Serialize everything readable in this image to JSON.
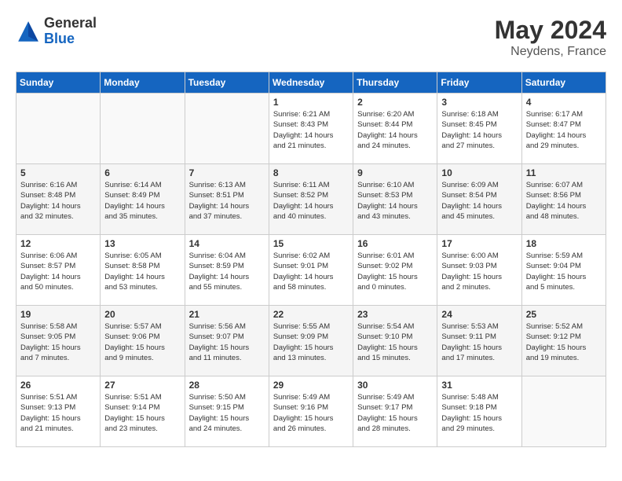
{
  "header": {
    "logo_general": "General",
    "logo_blue": "Blue",
    "month_year": "May 2024",
    "location": "Neydens, France"
  },
  "days_of_week": [
    "Sunday",
    "Monday",
    "Tuesday",
    "Wednesday",
    "Thursday",
    "Friday",
    "Saturday"
  ],
  "weeks": [
    [
      {
        "day": "",
        "content": ""
      },
      {
        "day": "",
        "content": ""
      },
      {
        "day": "",
        "content": ""
      },
      {
        "day": "1",
        "content": "Sunrise: 6:21 AM\nSunset: 8:43 PM\nDaylight: 14 hours\nand 21 minutes."
      },
      {
        "day": "2",
        "content": "Sunrise: 6:20 AM\nSunset: 8:44 PM\nDaylight: 14 hours\nand 24 minutes."
      },
      {
        "day": "3",
        "content": "Sunrise: 6:18 AM\nSunset: 8:45 PM\nDaylight: 14 hours\nand 27 minutes."
      },
      {
        "day": "4",
        "content": "Sunrise: 6:17 AM\nSunset: 8:47 PM\nDaylight: 14 hours\nand 29 minutes."
      }
    ],
    [
      {
        "day": "5",
        "content": "Sunrise: 6:16 AM\nSunset: 8:48 PM\nDaylight: 14 hours\nand 32 minutes."
      },
      {
        "day": "6",
        "content": "Sunrise: 6:14 AM\nSunset: 8:49 PM\nDaylight: 14 hours\nand 35 minutes."
      },
      {
        "day": "7",
        "content": "Sunrise: 6:13 AM\nSunset: 8:51 PM\nDaylight: 14 hours\nand 37 minutes."
      },
      {
        "day": "8",
        "content": "Sunrise: 6:11 AM\nSunset: 8:52 PM\nDaylight: 14 hours\nand 40 minutes."
      },
      {
        "day": "9",
        "content": "Sunrise: 6:10 AM\nSunset: 8:53 PM\nDaylight: 14 hours\nand 43 minutes."
      },
      {
        "day": "10",
        "content": "Sunrise: 6:09 AM\nSunset: 8:54 PM\nDaylight: 14 hours\nand 45 minutes."
      },
      {
        "day": "11",
        "content": "Sunrise: 6:07 AM\nSunset: 8:56 PM\nDaylight: 14 hours\nand 48 minutes."
      }
    ],
    [
      {
        "day": "12",
        "content": "Sunrise: 6:06 AM\nSunset: 8:57 PM\nDaylight: 14 hours\nand 50 minutes."
      },
      {
        "day": "13",
        "content": "Sunrise: 6:05 AM\nSunset: 8:58 PM\nDaylight: 14 hours\nand 53 minutes."
      },
      {
        "day": "14",
        "content": "Sunrise: 6:04 AM\nSunset: 8:59 PM\nDaylight: 14 hours\nand 55 minutes."
      },
      {
        "day": "15",
        "content": "Sunrise: 6:02 AM\nSunset: 9:01 PM\nDaylight: 14 hours\nand 58 minutes."
      },
      {
        "day": "16",
        "content": "Sunrise: 6:01 AM\nSunset: 9:02 PM\nDaylight: 15 hours\nand 0 minutes."
      },
      {
        "day": "17",
        "content": "Sunrise: 6:00 AM\nSunset: 9:03 PM\nDaylight: 15 hours\nand 2 minutes."
      },
      {
        "day": "18",
        "content": "Sunrise: 5:59 AM\nSunset: 9:04 PM\nDaylight: 15 hours\nand 5 minutes."
      }
    ],
    [
      {
        "day": "19",
        "content": "Sunrise: 5:58 AM\nSunset: 9:05 PM\nDaylight: 15 hours\nand 7 minutes."
      },
      {
        "day": "20",
        "content": "Sunrise: 5:57 AM\nSunset: 9:06 PM\nDaylight: 15 hours\nand 9 minutes."
      },
      {
        "day": "21",
        "content": "Sunrise: 5:56 AM\nSunset: 9:07 PM\nDaylight: 15 hours\nand 11 minutes."
      },
      {
        "day": "22",
        "content": "Sunrise: 5:55 AM\nSunset: 9:09 PM\nDaylight: 15 hours\nand 13 minutes."
      },
      {
        "day": "23",
        "content": "Sunrise: 5:54 AM\nSunset: 9:10 PM\nDaylight: 15 hours\nand 15 minutes."
      },
      {
        "day": "24",
        "content": "Sunrise: 5:53 AM\nSunset: 9:11 PM\nDaylight: 15 hours\nand 17 minutes."
      },
      {
        "day": "25",
        "content": "Sunrise: 5:52 AM\nSunset: 9:12 PM\nDaylight: 15 hours\nand 19 minutes."
      }
    ],
    [
      {
        "day": "26",
        "content": "Sunrise: 5:51 AM\nSunset: 9:13 PM\nDaylight: 15 hours\nand 21 minutes."
      },
      {
        "day": "27",
        "content": "Sunrise: 5:51 AM\nSunset: 9:14 PM\nDaylight: 15 hours\nand 23 minutes."
      },
      {
        "day": "28",
        "content": "Sunrise: 5:50 AM\nSunset: 9:15 PM\nDaylight: 15 hours\nand 24 minutes."
      },
      {
        "day": "29",
        "content": "Sunrise: 5:49 AM\nSunset: 9:16 PM\nDaylight: 15 hours\nand 26 minutes."
      },
      {
        "day": "30",
        "content": "Sunrise: 5:49 AM\nSunset: 9:17 PM\nDaylight: 15 hours\nand 28 minutes."
      },
      {
        "day": "31",
        "content": "Sunrise: 5:48 AM\nSunset: 9:18 PM\nDaylight: 15 hours\nand 29 minutes."
      },
      {
        "day": "",
        "content": ""
      }
    ]
  ]
}
